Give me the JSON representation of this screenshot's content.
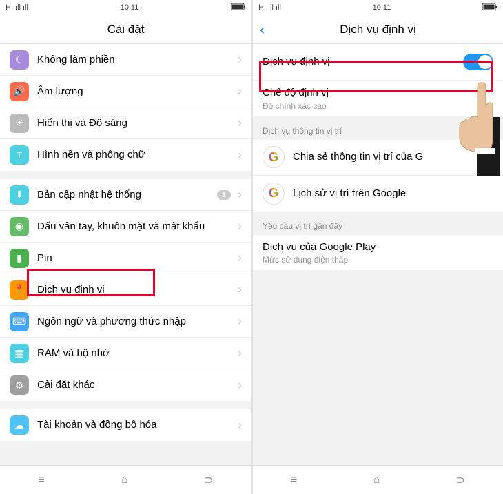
{
  "status": {
    "signal": "H ııll",
    "dots": "ıll",
    "time": "10:11"
  },
  "left": {
    "title": "Cài đặt",
    "groups": [
      {
        "rows": [
          {
            "icon": "ic-moon",
            "glyph": "☾",
            "label": "Không làm phiền"
          },
          {
            "icon": "ic-sound",
            "glyph": "🔊",
            "label": "Âm lượng"
          },
          {
            "icon": "ic-bright",
            "glyph": "☀",
            "label": "Hiển thị và Độ sáng"
          },
          {
            "icon": "ic-font",
            "glyph": "T",
            "label": "Hình nền và phông chữ"
          }
        ]
      },
      {
        "rows": [
          {
            "icon": "ic-update",
            "glyph": "⬇",
            "label": "Bản cập nhật hệ thống",
            "badge": "1"
          },
          {
            "icon": "ic-fp",
            "glyph": "◉",
            "label": "Dấu vân tay, khuôn mặt và mật khẩu"
          },
          {
            "icon": "ic-pin",
            "glyph": "▮",
            "label": "Pin"
          },
          {
            "icon": "ic-loc",
            "glyph": "📍",
            "label": "Dịch vụ định vị"
          },
          {
            "icon": "ic-lang",
            "glyph": "⌨",
            "label": "Ngôn ngữ và phương thức nhập"
          },
          {
            "icon": "ic-ram",
            "glyph": "▦",
            "label": "RAM và bộ nhớ"
          },
          {
            "icon": "ic-other",
            "glyph": "⚙",
            "label": "Cài đặt khác"
          }
        ]
      },
      {
        "rows": [
          {
            "icon": "ic-acct",
            "glyph": "☁",
            "label": "Tài khoản và đồng bộ hóa"
          }
        ]
      }
    ]
  },
  "right": {
    "title": "Dịch vụ định vị",
    "toggle_row": {
      "label": "Dịch vụ định vị"
    },
    "mode_row": {
      "label": "Chế độ định vị",
      "sub": "Độ chính xác cao"
    },
    "section1": "Dịch vụ thông tin vị trí",
    "g_rows": [
      {
        "label": "Chia sẻ thông tin vị trí của G"
      },
      {
        "label": "Lịch sử vị trí trên Google"
      }
    ],
    "section2": "Yêu cầu vị trí gần đây",
    "recent": {
      "label": "Dịch vụ của Google Play",
      "sub": "Mức sử dụng điện thấp"
    }
  }
}
